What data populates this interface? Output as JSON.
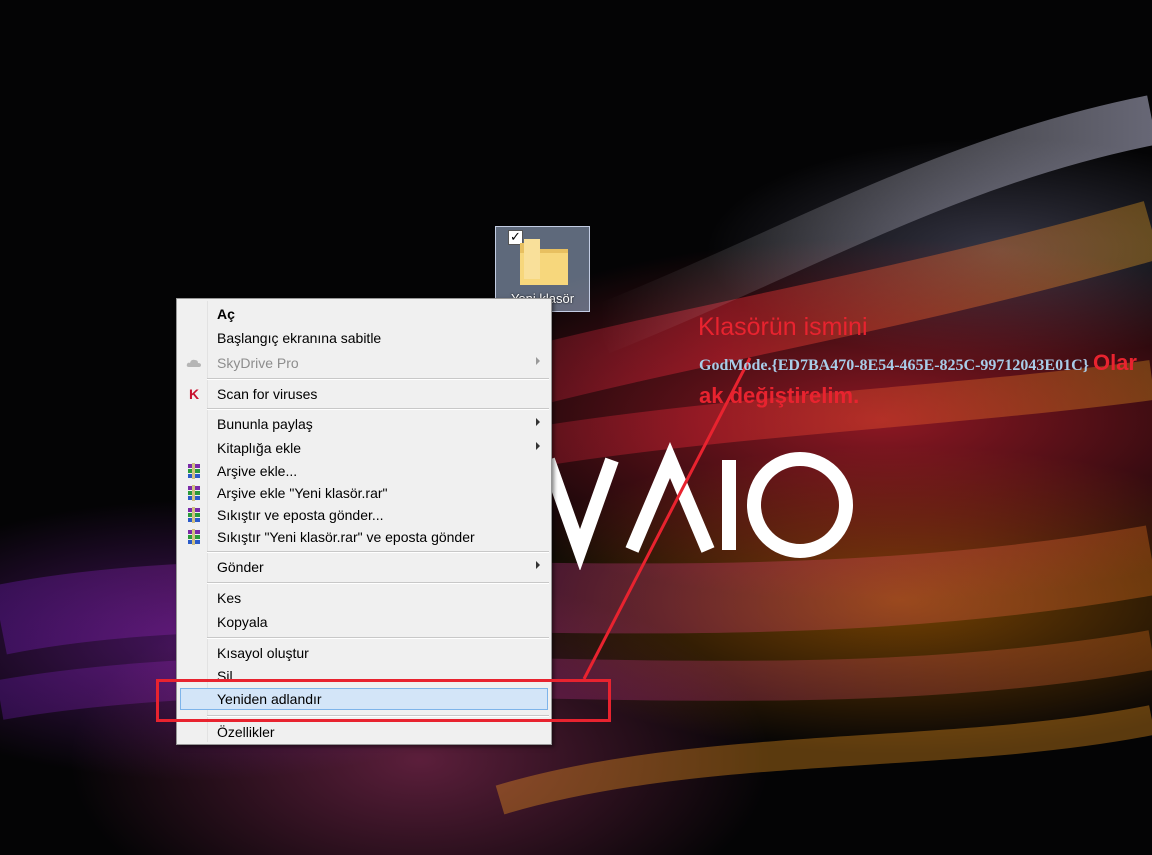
{
  "desktop": {
    "wallpaper": "vaio-wallpaper",
    "logo_text": "VAIO",
    "folder": {
      "label": "Yeni klasör",
      "icon": "folder-icon",
      "selected": true
    }
  },
  "context_menu": {
    "items": [
      {
        "label": "Aç",
        "bold": true
      },
      {
        "label": "Başlangıç ekranına sabitle"
      },
      {
        "label": "SkyDrive Pro",
        "disabled": true,
        "submenu": true,
        "icon": "cloud-icon"
      },
      {
        "label": "Scan for viruses",
        "icon": "kaspersky-icon"
      },
      {
        "label": "Bununla paylaş",
        "submenu": true
      },
      {
        "label": "Kitaplığa ekle",
        "submenu": true
      },
      {
        "label": "Arşive ekle...",
        "icon": "winrar-icon"
      },
      {
        "label": "Arşive ekle \"Yeni klasör.rar\"",
        "icon": "winrar-icon"
      },
      {
        "label": "Sıkıştır ve eposta gönder...",
        "icon": "winrar-icon"
      },
      {
        "label": "Sıkıştır \"Yeni klasör.rar\" ve eposta gönder",
        "icon": "winrar-icon"
      },
      {
        "label": "Gönder",
        "submenu": true
      },
      {
        "label": "Kes"
      },
      {
        "label": "Kopyala"
      },
      {
        "label": "Kısayol oluştur"
      },
      {
        "label": "Sil"
      },
      {
        "label": "Yeniden adlandır",
        "highlighted": true
      },
      {
        "label": "Özellikler"
      }
    ]
  },
  "annotation": {
    "title": "Klasörün ismini",
    "code": "GodMode.{ED7BA470-8E54-465E-825C-99712043E01C}",
    "instruction": "Olarak değiştirelim.",
    "color": "#e8232f"
  }
}
